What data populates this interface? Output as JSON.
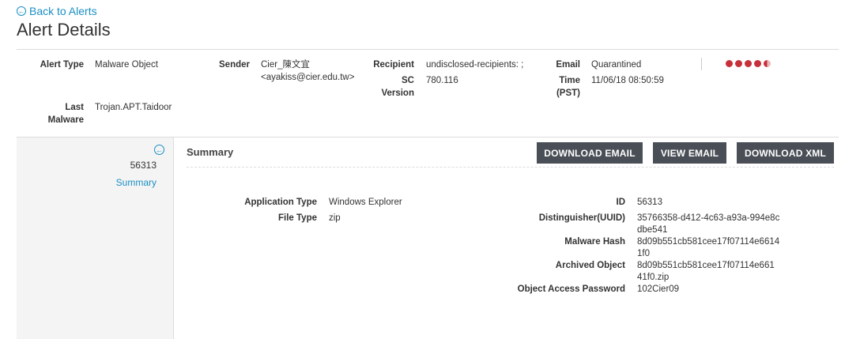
{
  "nav": {
    "back_label": "Back to Alerts"
  },
  "page": {
    "title": "Alert Details"
  },
  "alert": {
    "type_label": "Alert Type",
    "type_value": "Malware Object",
    "sender_label": "Sender",
    "sender_name": "Cier_陳文宜",
    "sender_email": "<ayakiss@cier.edu.tw>",
    "recipient_label": "Recipient",
    "recipient_value": "undisclosed-recipients: ;",
    "sc_version_label": "SC Version",
    "sc_version_value": "780.116",
    "email_label": "Email",
    "email_value": "Quarantined",
    "time_label": "Time (PST)",
    "time_value": "11/06/18 08:50:59",
    "last_malware_label": "Last Malware",
    "last_malware_value": "Trojan.APT.Taidoor",
    "severity_dots": 4.5,
    "severity_color": "#c7303a"
  },
  "sidebar": {
    "alert_id": "56313",
    "link_label": "Summary"
  },
  "summary": {
    "title": "Summary",
    "buttons": {
      "download_email": "DOWNLOAD EMAIL",
      "view_email": "VIEW EMAIL",
      "download_xml": "DOWNLOAD XML"
    },
    "left": {
      "app_type_label": "Application Type",
      "app_type_value": "Windows Explorer",
      "file_type_label": "File Type",
      "file_type_value": "zip"
    },
    "right": {
      "id_label": "ID",
      "id_value": "56313",
      "uuid_label": "Distinguisher(UUID)",
      "uuid_value_1": "35766358-d412-4c63-a93a-994e8c",
      "uuid_value_2": "dbe541",
      "hash_label": "Malware Hash",
      "hash_value_1": "8d09b551cb581cee17f07114e6614",
      "hash_value_2": "1f0",
      "archived_label": "Archived Object",
      "archived_value_1": "8d09b551cb581cee17f07114e661",
      "archived_value_2": "41f0.zip",
      "password_label": "Object Access Password",
      "password_value": "102Cier09"
    }
  },
  "colors": {
    "accent": "#1a8fc4",
    "button_bg": "#4a4f57"
  }
}
